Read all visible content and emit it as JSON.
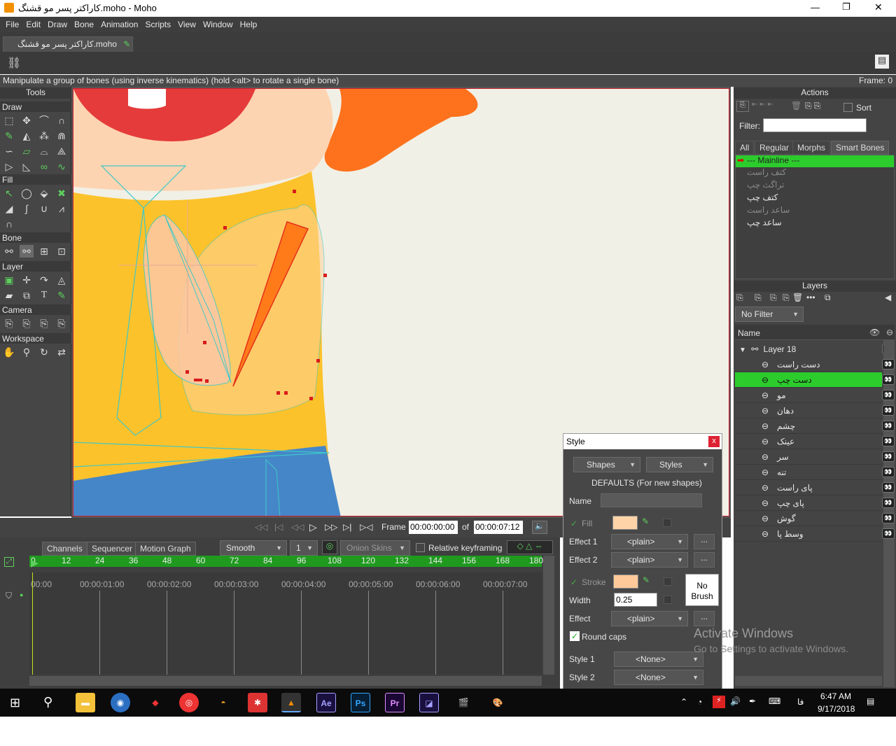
{
  "window": {
    "title": "کاراکتر پسر مو قشنگ.moho - Moho",
    "min": "—",
    "max": "❐",
    "close": "✕"
  },
  "menu": [
    "File",
    "Edit",
    "Draw",
    "Bone",
    "Animation",
    "Scripts",
    "View",
    "Window",
    "Help"
  ],
  "doc_tab": "کاراکتر پسر مو قشنگ.moho",
  "status": {
    "message": "Manipulate a group of bones (using inverse kinematics) (hold <alt> to rotate a single bone)",
    "frame": "Frame: 0"
  },
  "tools": {
    "header": "Tools",
    "sections": [
      "Draw",
      "Fill",
      "Bone",
      "Layer",
      "Camera",
      "Workspace"
    ]
  },
  "playback": {
    "frame_label": "Frame",
    "frame_value": "00:00:00:00",
    "of_label": "of",
    "total_value": "00:00:07:12"
  },
  "timeline": {
    "tabs": [
      "Channels",
      "Sequencer",
      "Motion Graph"
    ],
    "interp": "Smooth",
    "interp_count": "1",
    "onion": "Onion Skins",
    "relative": "Relative keyframing",
    "ruler": [
      "0",
      "12",
      "24",
      "36",
      "48",
      "60",
      "72",
      "84",
      "96",
      "108",
      "120",
      "132",
      "144",
      "156",
      "168",
      "180"
    ],
    "times": [
      "00:00",
      "00:00:01:00",
      "00:00:02:00",
      "00:00:03:00",
      "00:00:04:00",
      "00:00:05:00",
      "00:00:06:00",
      "00:00:07:00"
    ]
  },
  "actions": {
    "header": "Actions",
    "sort": "Sort",
    "filter_label": "Filter:",
    "tabs": [
      "All",
      "Regular",
      "Morphs",
      "Smart Bones"
    ],
    "items": [
      {
        "label": "--- Mainline ---",
        "active": true
      },
      {
        "label": "کتف راست",
        "dim": true
      },
      {
        "label": "تراگث چپ",
        "dim": true
      },
      {
        "label": "کتف چپ",
        "dim": false
      },
      {
        "label": "ساعد راست",
        "dim": true
      },
      {
        "label": "ساعد چپ",
        "dim": false
      }
    ]
  },
  "layers": {
    "header": "Layers",
    "filter": "No Filter",
    "col_name": "Name",
    "group": "Layer 18",
    "items": [
      {
        "label": "دست راست",
        "selected": false
      },
      {
        "label": "دست چپ",
        "selected": true
      },
      {
        "label": "مو",
        "selected": false
      },
      {
        "label": "دهان",
        "selected": false
      },
      {
        "label": "چشم",
        "selected": false
      },
      {
        "label": "عینک",
        "selected": false
      },
      {
        "label": "سر",
        "selected": false
      },
      {
        "label": "تنه",
        "selected": false
      },
      {
        "label": "پای راست",
        "selected": false
      },
      {
        "label": "پای چپ",
        "selected": false
      },
      {
        "label": "گوش",
        "selected": false
      },
      {
        "label": "وسط پا",
        "selected": false
      }
    ]
  },
  "style": {
    "title": "Style",
    "close": "x",
    "shapes": "Shapes",
    "styles": "Styles",
    "defaults": "DEFAULTS (For new shapes)",
    "name_label": "Name",
    "fill_label": "Fill",
    "effect1_label": "Effect 1",
    "effect1": "<plain>",
    "effect2_label": "Effect 2",
    "effect2": "<plain>",
    "stroke_label": "Stroke",
    "width_label": "Width",
    "width_value": "0.25",
    "effect_label": "Effect",
    "effect": "<plain>",
    "no_brush": "No Brush",
    "round_caps": "Round caps",
    "style1_label": "Style 1",
    "style1": "<None>",
    "style2_label": "Style 2",
    "style2": "<None>",
    "more": "...",
    "fill_color": "#ffd3a8",
    "stroke_color": "#ffc999"
  },
  "watermark": {
    "line1": "Activate Windows",
    "line2": "Go to Settings to activate Windows."
  },
  "taskbar": {
    "time": "6:47 AM",
    "date": "9/17/2018",
    "lang": "فا",
    "apps": [
      "Ae",
      "Ps",
      "Pr"
    ]
  },
  "colors": {
    "accent_green": "#2dcc2d",
    "ui_dark": "#3f3f3f",
    "bone_cyan": "#3ec8c8",
    "shirt": "#fcc22b",
    "skin": "#ffd3a8",
    "selected_bone": "#ff7b1a"
  }
}
